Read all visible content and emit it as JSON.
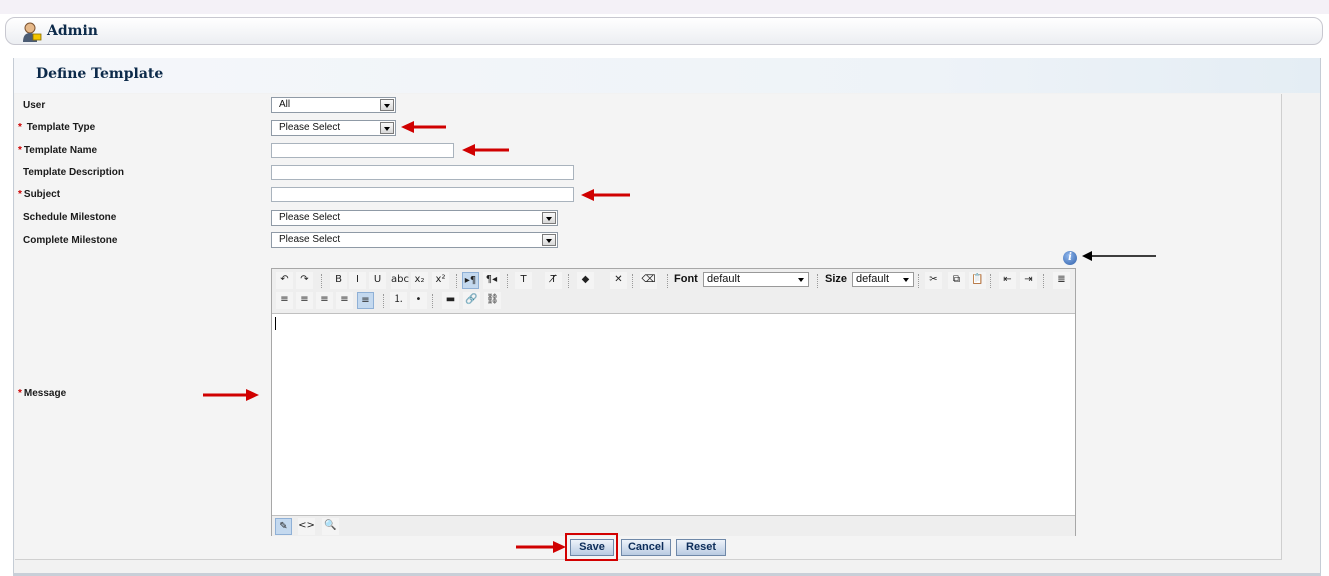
{
  "header": {
    "title": "Admin"
  },
  "panel": {
    "title": "Define Template"
  },
  "form": {
    "user": {
      "label": "User",
      "value": "All"
    },
    "template_type": {
      "required": "*",
      "label": "Template Type",
      "value": "Please Select"
    },
    "template_name": {
      "required": "*",
      "label": "Template Name",
      "value": ""
    },
    "template_description": {
      "label": "Template Description",
      "value": ""
    },
    "subject": {
      "required": "*",
      "label": "Subject",
      "value": ""
    },
    "schedule_milestone": {
      "label": "Schedule Milestone",
      "value": "Please Select"
    },
    "complete_milestone": {
      "label": "Complete Milestone",
      "value": "Please Select"
    },
    "message": {
      "required": "*",
      "label": "Message"
    }
  },
  "editor": {
    "buttons_row1": [
      {
        "name": "undo-icon",
        "glyph": "↶"
      },
      {
        "name": "redo-icon",
        "glyph": "↷"
      },
      {
        "name": "bold-icon",
        "glyph": "B"
      },
      {
        "name": "italic-icon",
        "glyph": "I"
      },
      {
        "name": "underline-icon",
        "glyph": "U"
      },
      {
        "name": "strikethrough-icon",
        "glyph": "abc"
      },
      {
        "name": "subscript-icon",
        "glyph": "x₂"
      },
      {
        "name": "superscript-icon",
        "glyph": "x²"
      },
      {
        "name": "ltr-icon",
        "glyph": "▸¶"
      },
      {
        "name": "rtl-icon",
        "glyph": "¶◂"
      },
      {
        "name": "text-color-icon",
        "glyph": "T"
      },
      {
        "name": "clear-format-icon",
        "glyph": "T̸"
      },
      {
        "name": "highlight-color-icon",
        "glyph": "◆"
      },
      {
        "name": "clear-highlight-icon",
        "glyph": "✕"
      },
      {
        "name": "eraser-icon",
        "glyph": "⌫"
      },
      {
        "name": "cut-icon",
        "glyph": "✂"
      },
      {
        "name": "copy-icon",
        "glyph": "⧉"
      },
      {
        "name": "paste-icon",
        "glyph": "📋"
      },
      {
        "name": "outdent-icon",
        "glyph": "⇤"
      },
      {
        "name": "indent-icon",
        "glyph": "⇥"
      },
      {
        "name": "paragraph-icon",
        "glyph": "≣"
      }
    ],
    "buttons_row2": [
      {
        "name": "align-left-icon",
        "glyph": "≡"
      },
      {
        "name": "align-center-icon",
        "glyph": "≡"
      },
      {
        "name": "align-right-icon",
        "glyph": "≡"
      },
      {
        "name": "justify-icon",
        "glyph": "≡"
      },
      {
        "name": "justify-full-icon",
        "glyph": "≡"
      },
      {
        "name": "ordered-list-icon",
        "glyph": "⒈"
      },
      {
        "name": "unordered-list-icon",
        "glyph": "•"
      },
      {
        "name": "horizontal-rule-icon",
        "glyph": "▬"
      },
      {
        "name": "insert-link-icon",
        "glyph": "🔗"
      },
      {
        "name": "remove-link-icon",
        "glyph": "⛓"
      }
    ],
    "font_label": "Font",
    "font_value": "default",
    "size_label": "Size",
    "size_value": "default",
    "bottom_buttons": [
      {
        "name": "design-mode-icon",
        "glyph": "✎"
      },
      {
        "name": "html-mode-icon",
        "glyph": "<>"
      },
      {
        "name": "preview-icon",
        "glyph": "🔍"
      }
    ]
  },
  "actions": {
    "save": "Save",
    "cancel": "Cancel",
    "reset": "Reset"
  },
  "colors": {
    "title": "#0c2a4a",
    "required": "#cc0000",
    "annotation_arrow": "#d00000",
    "save_highlight": "#d20000"
  }
}
